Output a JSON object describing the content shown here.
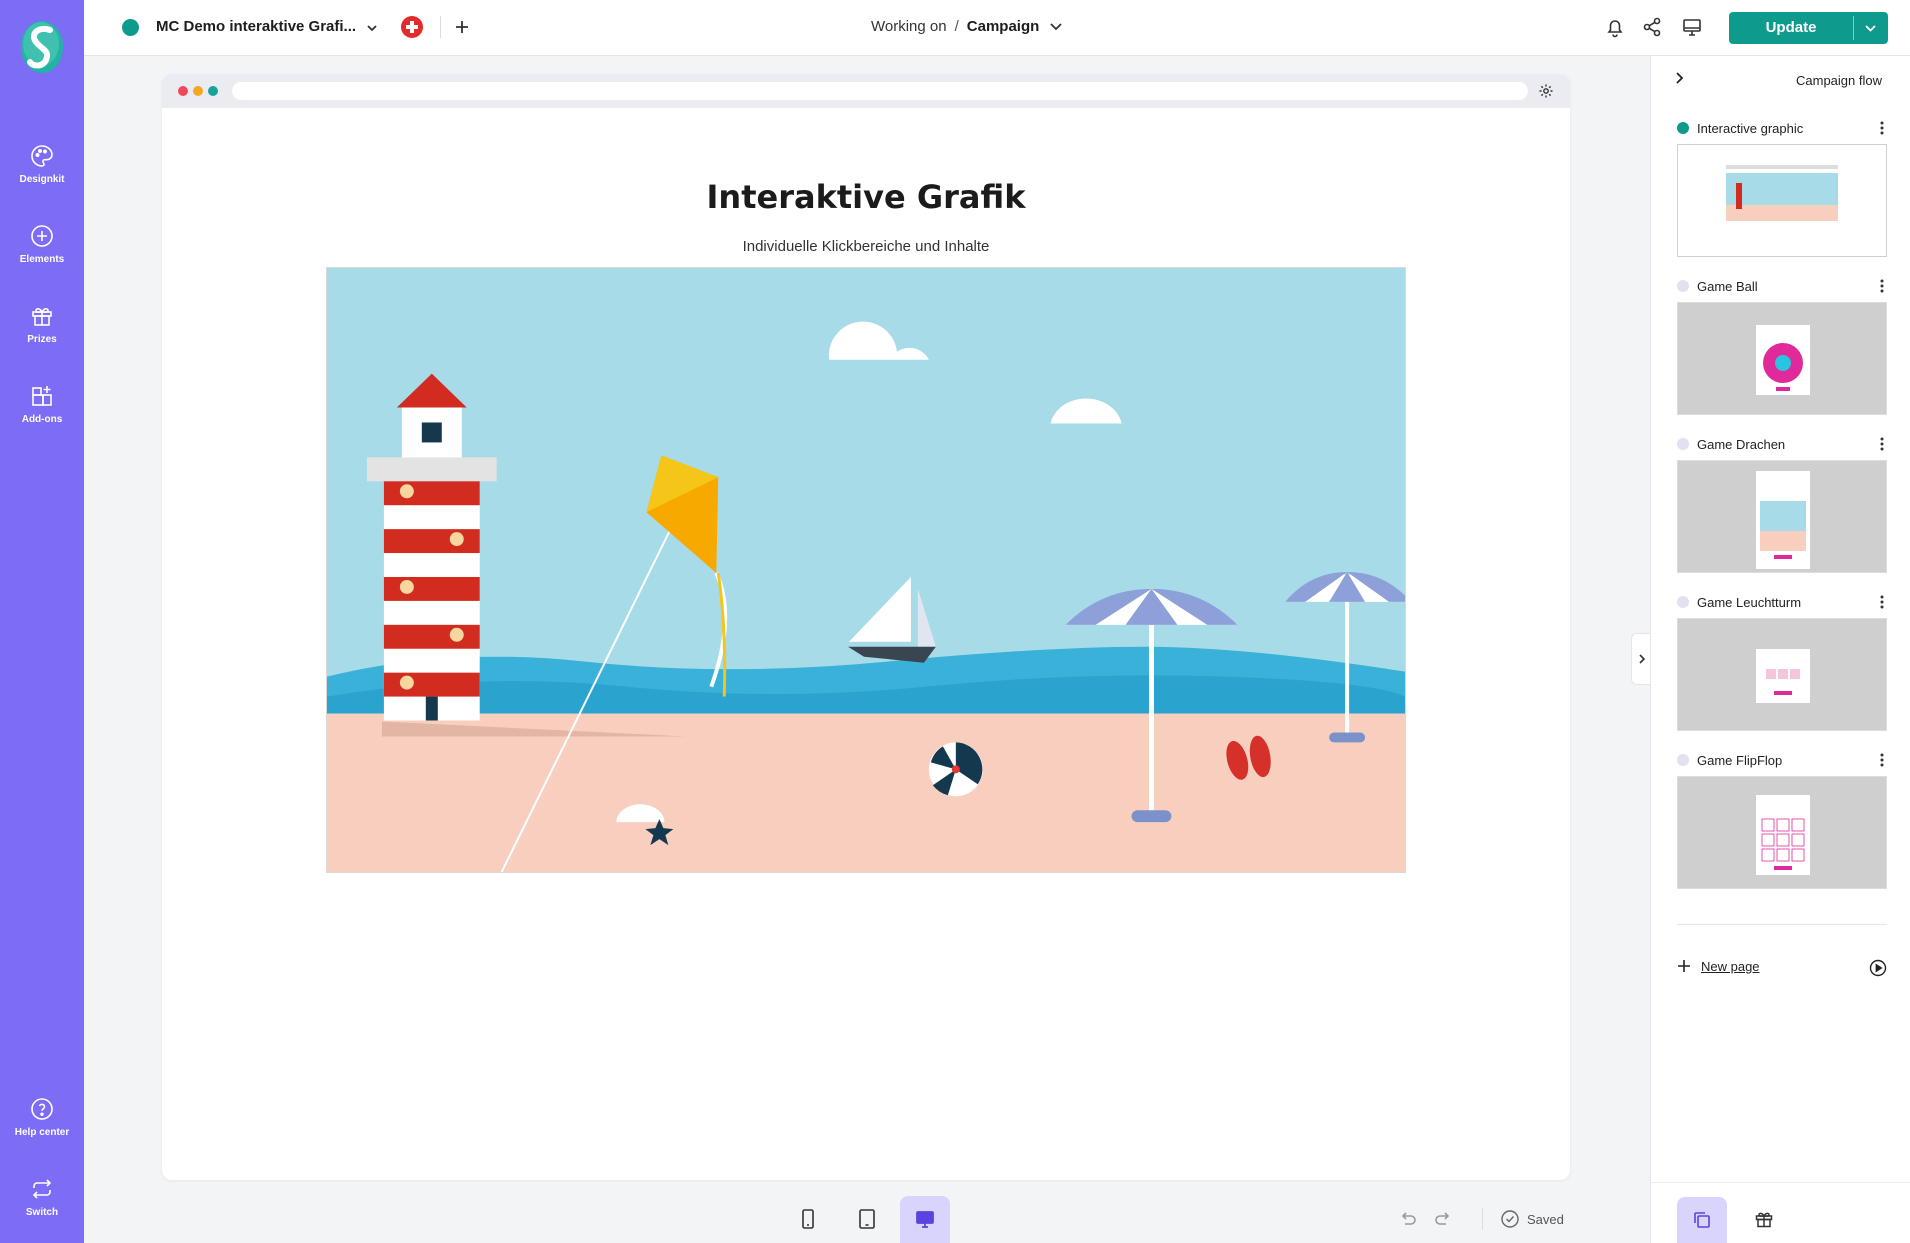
{
  "sidebar": {
    "items": [
      {
        "label": "Designkit",
        "icon": "palette-icon"
      },
      {
        "label": "Elements",
        "icon": "plus-circle-icon"
      },
      {
        "label": "Prizes",
        "icon": "gift-icon"
      },
      {
        "label": "Add-ons",
        "icon": "add-ons-icon"
      }
    ],
    "bottom": [
      {
        "label": "Help center",
        "icon": "help-icon"
      },
      {
        "label": "Switch",
        "icon": "switch-icon"
      }
    ]
  },
  "topbar": {
    "project_name": "MC Demo interaktive Grafi...",
    "breadcrumb_prefix": "Working on",
    "breadcrumb_separator": "/",
    "breadcrumb_current": "Campaign",
    "update_label": "Update"
  },
  "canvas": {
    "title": "Interaktive Grafik",
    "subtitle": "Individuelle Klickbereiche und Inhalte"
  },
  "bottombar": {
    "saved_label": "Saved",
    "active_device": "desktop"
  },
  "rightpanel": {
    "title": "Campaign flow",
    "pages": [
      {
        "name": "Interactive graphic",
        "active": true
      },
      {
        "name": "Game Ball",
        "active": false
      },
      {
        "name": "Game Drachen",
        "active": false
      },
      {
        "name": "Game Leuchtturm",
        "active": false
      },
      {
        "name": "Game FlipFlop",
        "active": false
      }
    ],
    "new_page_label": "New page"
  },
  "colors": {
    "sidebar": "#7c6cf6",
    "accent": "#0f9a8e",
    "active_tab": "#d9d4fb"
  }
}
